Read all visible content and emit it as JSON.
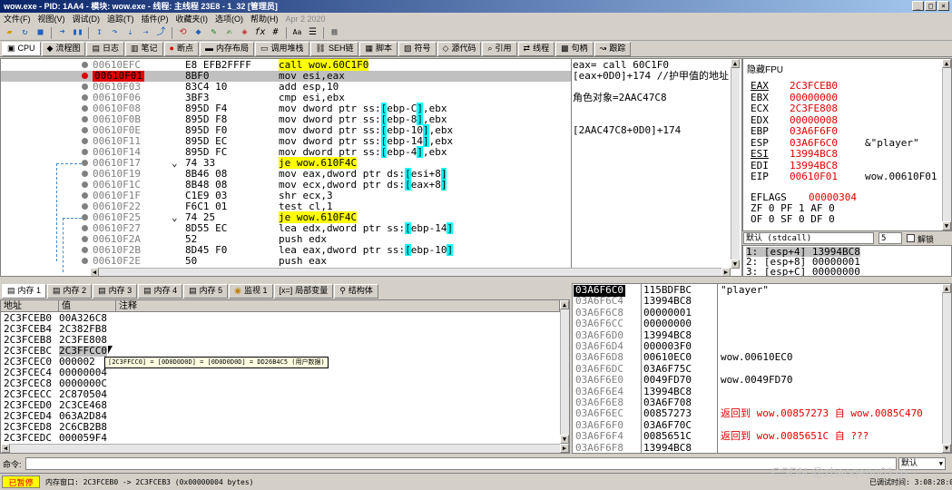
{
  "window": {
    "title": "wow.exe - PID: 1AA4 - 模块: wow.exe - 线程: 主线程 23E8 - 1_32 [管理员]"
  },
  "menu": {
    "items": [
      "文件(F)",
      "视图(V)",
      "调试(D)",
      "追踪(T)",
      "插件(P)",
      "收藏夹(I)",
      "选项(O)",
      "帮助(H)"
    ],
    "date": "Apr 2 2020"
  },
  "toolbar": {
    "fx": "fx",
    "hash": "#",
    "az": "Aa"
  },
  "tabs": [
    {
      "label": "CPU",
      "icon": "cpu-icon"
    },
    {
      "label": "流程图",
      "icon": "graph-icon"
    },
    {
      "label": "日志",
      "icon": "log-icon"
    },
    {
      "label": "笔记",
      "icon": "notes-icon"
    },
    {
      "label": "断点",
      "icon": "breakpoint-icon"
    },
    {
      "label": "内存布局",
      "icon": "memory-map-icon"
    },
    {
      "label": "调用堆栈",
      "icon": "callstack-icon"
    },
    {
      "label": "SEH链",
      "icon": "seh-icon"
    },
    {
      "label": "脚本",
      "icon": "script-icon"
    },
    {
      "label": "符号",
      "icon": "symbols-icon"
    },
    {
      "label": "源代码",
      "icon": "source-icon"
    },
    {
      "label": "引用",
      "icon": "references-icon"
    },
    {
      "label": "线程",
      "icon": "threads-icon"
    },
    {
      "label": "句柄",
      "icon": "handles-icon"
    },
    {
      "label": "跟踪",
      "icon": "trace-icon"
    }
  ],
  "eip_label": "EIP",
  "disasm": [
    {
      "addr": "00610EFC",
      "bytes": "E8 EFB2FFFF",
      "ins": "call wow.60C1F0",
      "hl": "call",
      "dot": "gray"
    },
    {
      "addr": "00610F01",
      "bytes": "8BF0",
      "ins": "mov esi,eax",
      "sel": true,
      "dot": "red"
    },
    {
      "addr": "00610F03",
      "bytes": "83C4 10",
      "ins": "add esp,10",
      "dot": "gray"
    },
    {
      "addr": "00610F06",
      "bytes": "3BF3",
      "ins": "cmp esi,ebx",
      "dot": "gray"
    },
    {
      "addr": "00610F08",
      "bytes": "895D F4",
      "ins": "mov dword ptr ss:[ebp-C],ebx",
      "ref": "[ebp-C]",
      "dot": "gray"
    },
    {
      "addr": "00610F0B",
      "bytes": "895D F8",
      "ins": "mov dword ptr ss:[ebp-8],ebx",
      "ref": "[ebp-8]",
      "dot": "gray"
    },
    {
      "addr": "00610F0E",
      "bytes": "895D F0",
      "ins": "mov dword ptr ss:[ebp-10],ebx",
      "ref": "[ebp-10]",
      "dot": "gray"
    },
    {
      "addr": "00610F11",
      "bytes": "895D EC",
      "ins": "mov dword ptr ss:[ebp-14],ebx",
      "ref": "[ebp-14]",
      "dot": "gray"
    },
    {
      "addr": "00610F14",
      "bytes": "895D FC",
      "ins": "mov dword ptr ss:[ebp-4],ebx",
      "ref": "[ebp-4]",
      "dot": "gray"
    },
    {
      "addr": "00610F17",
      "bytes": "74 33",
      "ins": "je wow.610F4C",
      "hl": "je",
      "jmp": "v",
      "dot": "gray"
    },
    {
      "addr": "00610F19",
      "bytes": "8B46 08",
      "ins": "mov eax,dword ptr ds:[esi+8]",
      "ref": "[esi+8]",
      "dot": "gray"
    },
    {
      "addr": "00610F1C",
      "bytes": "8B48 08",
      "ins": "mov ecx,dword ptr ds:[eax+8]",
      "ref": "[eax+8]",
      "dot": "gray"
    },
    {
      "addr": "00610F1F",
      "bytes": "C1E9 03",
      "ins": "shr ecx,3",
      "dot": "gray"
    },
    {
      "addr": "00610F22",
      "bytes": "F6C1 01",
      "ins": "test cl,1",
      "dot": "gray"
    },
    {
      "addr": "00610F25",
      "bytes": "74 25",
      "ins": "je wow.610F4C",
      "hl": "je",
      "jmp": "v",
      "dot": "gray"
    },
    {
      "addr": "00610F27",
      "bytes": "8D55 EC",
      "ins": "lea edx,dword ptr ss:[ebp-14]",
      "ref": "[ebp-14]",
      "dot": "gray"
    },
    {
      "addr": "00610F2A",
      "bytes": "52",
      "ins": "push edx",
      "dot": "gray"
    },
    {
      "addr": "00610F2B",
      "bytes": "8D45 F0",
      "ins": "lea eax,dword ptr ss:[ebp-10]",
      "ref": "[ebp-10]",
      "dot": "gray"
    },
    {
      "addr": "00610F2E",
      "bytes": "50",
      "ins": "push eax",
      "dot": "gray"
    }
  ],
  "comments": [
    {
      "row": 0,
      "text": "eax= call 60C1F0"
    },
    {
      "row": 1,
      "text": "[eax+0D0]+174 //护甲值的地址"
    },
    {
      "row": 3,
      "text": "角色对象=2AAC47C8"
    },
    {
      "row": 6,
      "text": "[2AAC47C8+0D0]+174"
    }
  ],
  "registers": {
    "title": "隐藏FPU",
    "list": [
      {
        "name": "EAX",
        "value": "2C3FCEB0",
        "u": true
      },
      {
        "name": "EBX",
        "value": "00000000"
      },
      {
        "name": "ECX",
        "value": "2C3FE808"
      },
      {
        "name": "EDX",
        "value": "00000008"
      },
      {
        "name": "EBP",
        "value": "03A6F6F0"
      },
      {
        "name": "ESP",
        "value": "03A6F6C0",
        "note": "&\"player\""
      },
      {
        "name": "ESI",
        "value": "13994BC8",
        "u": true
      },
      {
        "name": "EDI",
        "value": "13994BC8"
      }
    ],
    "eip": {
      "name": "EIP",
      "value": "00610F01",
      "note": "wow.00610F01"
    },
    "eflags": {
      "name": "EFLAGS",
      "value": "00000304"
    },
    "flags1": "ZF 0  PF 1  AF 0",
    "flags2": "OF 0  SF 0  DF 0"
  },
  "callconv": {
    "value": "默认 (stdcall)",
    "count": "5",
    "unlock_label": "解锁"
  },
  "args": [
    "1: [esp+4] 13994BC8",
    "2: [esp+8] 00000001",
    "3: [esp+C] 00000000"
  ],
  "bottom_tabs": [
    {
      "label": "内存 1",
      "icon": "memory-icon"
    },
    {
      "label": "内存 2",
      "icon": "memory-icon"
    },
    {
      "label": "内存 3",
      "icon": "memory-icon"
    },
    {
      "label": "内存 4",
      "icon": "memory-icon"
    },
    {
      "label": "内存 5",
      "icon": "memory-icon"
    },
    {
      "label": "监视 1",
      "icon": "watch-icon"
    },
    {
      "label": "局部变量",
      "icon": "locals-icon"
    },
    {
      "label": "结构体",
      "icon": "struct-icon"
    }
  ],
  "dump": {
    "headers": [
      "地址",
      "值",
      "注释"
    ],
    "rows": [
      {
        "addr": "2C3FCEB0",
        "val": "00A326C8"
      },
      {
        "addr": "2C3FCEB4",
        "val": "2C382FB8"
      },
      {
        "addr": "2C3FCEB8",
        "val": "2C3FE808"
      },
      {
        "addr": "2C3FCEBC",
        "val": "2C3FFCC0",
        "sel": true
      },
      {
        "addr": "2C3FCEC0",
        "val": "000002"
      },
      {
        "addr": "2C3FCEC4",
        "val": "00000004"
      },
      {
        "addr": "2C3FCEC8",
        "val": "0000000C"
      },
      {
        "addr": "2C3FCECC",
        "val": "2C870504"
      },
      {
        "addr": "2C3FCED0",
        "val": "2C3CE468"
      },
      {
        "addr": "2C3FCED4",
        "val": "063A2D84"
      },
      {
        "addr": "2C3FCED8",
        "val": "2C6CB2B8"
      },
      {
        "addr": "2C3FCEDC",
        "val": "000059F4"
      }
    ],
    "tooltip": "[2C3FFCC0] = [0D0D0D0D] = [0D0D0D0D] = DD26B4C5 (用户数据)"
  },
  "stack": [
    {
      "addr": "03A6F6C0",
      "val": "115BDFBC",
      "cmt": "\"player\"",
      "sel": true
    },
    {
      "addr": "03A6F6C4",
      "val": "13994BC8"
    },
    {
      "addr": "03A6F6C8",
      "val": "00000001"
    },
    {
      "addr": "03A6F6CC",
      "val": "00000000"
    },
    {
      "addr": "03A6F6D0",
      "val": "13994BC8"
    },
    {
      "addr": "03A6F6D4",
      "val": "000003F0"
    },
    {
      "addr": "03A6F6D8",
      "val": "00610EC0",
      "cmt": "wow.00610EC0"
    },
    {
      "addr": "03A6F6DC",
      "val": "03A6F75C"
    },
    {
      "addr": "03A6F6E0",
      "val": "0049FD70",
      "cmt": "wow.0049FD70"
    },
    {
      "addr": "03A6F6E4",
      "val": "13994BC8"
    },
    {
      "addr": "03A6F6E8",
      "val": "03A6F708"
    },
    {
      "addr": "03A6F6EC",
      "val": "00857273",
      "cmt": "返回到 wow.00857273 自 wow.0085C470",
      "red": true
    },
    {
      "addr": "03A6F6F0",
      "val": "03A6F70C"
    },
    {
      "addr": "03A6F6F4",
      "val": "0085651C",
      "cmt": "返回到 wow.0085651C 自 ???",
      "red": true
    },
    {
      "addr": "03A6F6F8",
      "val": "13994BC8"
    }
  ],
  "command": {
    "label": "命令:",
    "mode": "默认"
  },
  "status": {
    "paused": "已暂停",
    "info": "内存窗口: 2C3FCEB0 -> 2C3FCEB3 (0x00000004 bytes)",
    "time": "已调试时间: 3:08:28:05"
  },
  "watermark": "CSDN @zhaoqeng01zp"
}
